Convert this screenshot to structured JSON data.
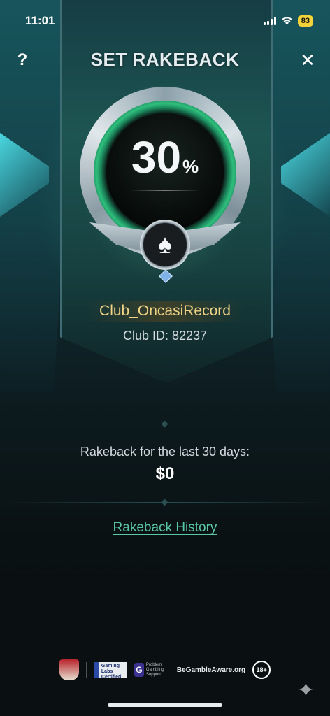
{
  "status_bar": {
    "time": "11:01",
    "battery": "83"
  },
  "header": {
    "title": "SET RAKEBACK",
    "help_label": "?",
    "close_label": "✕"
  },
  "rakeback_card": {
    "percent_value": "30",
    "percent_symbol": "%",
    "club_name": "Club_OncasiRecord",
    "club_id": "Club ID: 82237"
  },
  "summary": {
    "label": "Rakeback for the last 30 days:",
    "value": "$0"
  },
  "history_link": "Rakeback History",
  "footer": {
    "gli_text": "Gaming Labs Certified",
    "pgs_text": "Problem Gambling Support",
    "pgs_icon": "G",
    "begambleaware": "BeGambleAware.org",
    "age": "18+"
  },
  "icons": [
    "help-icon",
    "close-icon",
    "spade-icon",
    "sparkle-icon"
  ]
}
